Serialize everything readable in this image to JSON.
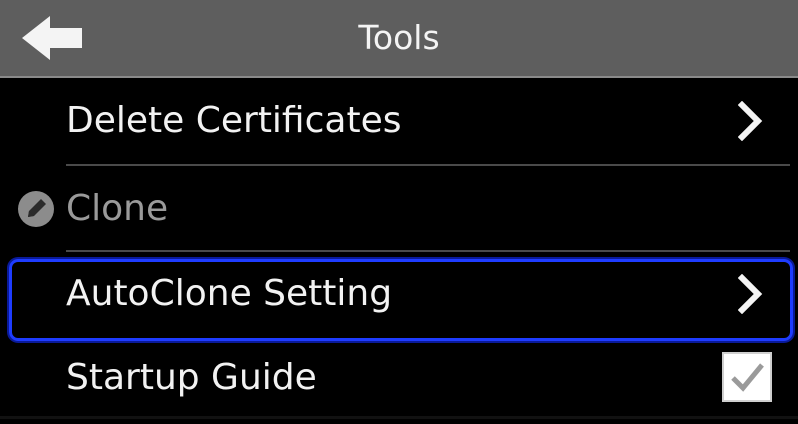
{
  "header": {
    "title": "Tools",
    "back_icon": "arrow-left-icon"
  },
  "list": {
    "items": [
      {
        "label": "Delete Certificates",
        "control": "chevron-right-icon",
        "enabled": true,
        "selected": false
      },
      {
        "label": "Clone",
        "control": "none",
        "enabled": false,
        "selected": false,
        "badge_icon": "pencil-icon"
      },
      {
        "label": "AutoClone Setting",
        "control": "chevron-right-icon",
        "enabled": true,
        "selected": true
      },
      {
        "label": "Startup Guide",
        "control": "checkbox",
        "enabled": true,
        "selected": false,
        "checked": true
      }
    ]
  },
  "colors": {
    "header_bg": "#5e5e5e",
    "screen_bg": "#000000",
    "selection_border": "#1e3cff",
    "text": "#f2f2f2",
    "disabled_text": "#9a9a9a"
  }
}
